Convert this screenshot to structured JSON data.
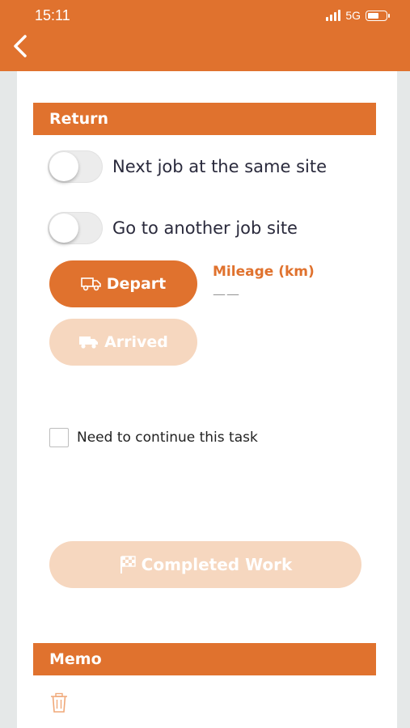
{
  "status_bar": {
    "time": "15:11",
    "network": "5G",
    "signal_icon": "signal-bars-icon",
    "battery_icon": "battery-icon"
  },
  "header": {
    "back_icon": "chevron-left-icon"
  },
  "return_section": {
    "title": "Return",
    "toggles": [
      {
        "label": "Next job at the same site",
        "on": false
      },
      {
        "label": "Go to another job site",
        "on": false
      }
    ],
    "depart_button": {
      "label": "Depart",
      "icon": "truck-outline-icon"
    },
    "arrived_button": {
      "label": "Arrived",
      "icon": "truck-filled-icon",
      "disabled": true
    },
    "mileage": {
      "label": "Mileage (km)",
      "value": "——"
    }
  },
  "continue_task": {
    "label": "Need to continue this task",
    "checked": false
  },
  "completed_button": {
    "label": "Completed Work",
    "icon": "checkered-flag-icon",
    "disabled": true
  },
  "memo_section": {
    "title": "Memo",
    "delete_icon": "trash-icon"
  },
  "colors": {
    "accent": "#e0722e",
    "accent_disabled": "#f6d7bf",
    "background": "#e5e8e8",
    "text": "#2a2a3c"
  }
}
